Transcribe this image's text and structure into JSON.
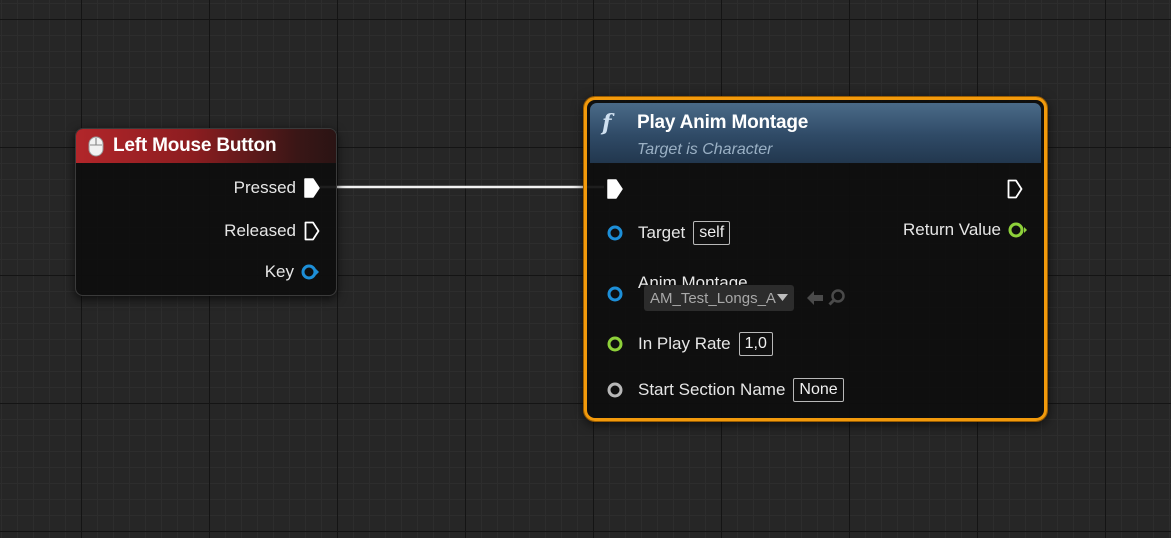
{
  "event_node": {
    "title": "Left Mouse Button",
    "pins": {
      "pressed": "Pressed",
      "released": "Released",
      "key": "Key"
    }
  },
  "function_node": {
    "title": "Play Anim Montage",
    "subtitle": "Target is Character",
    "pins": {
      "target_label": "Target",
      "target_value": "self",
      "return_value_label": "Return Value",
      "anim_montage_label": "Anim Montage",
      "anim_montage_value": "AM_Test_Longs_A",
      "in_play_rate_label": "In Play Rate",
      "in_play_rate_value": "1,0",
      "start_section_name_label": "Start Section Name",
      "start_section_name_value": "None"
    }
  },
  "colors": {
    "event_header": "#b2262a",
    "function_header": "#3b5a78",
    "selection_outline": "#f29a0c",
    "object_pin": "#1d8fd8",
    "float_pin": "#8ed13a",
    "name_pin": "#b8b8b8",
    "exec_pin": "#ffffff"
  },
  "icons": [
    "mouse-icon",
    "function-icon",
    "exec-pin-icon",
    "object-pin-icon",
    "float-pin-icon",
    "name-pin-icon",
    "dropdown-arrow-icon",
    "use-selected-arrow-icon",
    "browse-magnifier-icon"
  ]
}
